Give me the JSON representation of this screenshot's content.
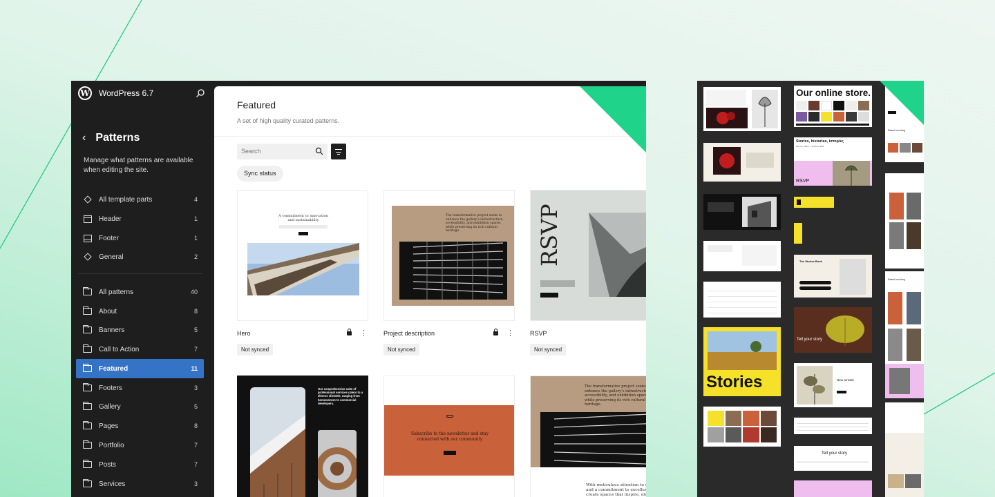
{
  "app": {
    "title": "WordPress 6.7"
  },
  "sidebar": {
    "back_title": "Patterns",
    "description": "Manage what patterns are available when editing the site.",
    "template_parts": [
      {
        "label": "All template parts",
        "count": "4",
        "icon": "diamond-icon"
      },
      {
        "label": "Header",
        "count": "1",
        "icon": "header-layout-icon"
      },
      {
        "label": "Footer",
        "count": "1",
        "icon": "footer-layout-icon"
      },
      {
        "label": "General",
        "count": "2",
        "icon": "diamond-icon"
      }
    ],
    "pattern_categories": [
      {
        "label": "All patterns",
        "count": "40"
      },
      {
        "label": "About",
        "count": "8"
      },
      {
        "label": "Banners",
        "count": "5"
      },
      {
        "label": "Call to Action",
        "count": "7"
      },
      {
        "label": "Featured",
        "count": "11",
        "active": true
      },
      {
        "label": "Footers",
        "count": "3"
      },
      {
        "label": "Gallery",
        "count": "5"
      },
      {
        "label": "Pages",
        "count": "8"
      },
      {
        "label": "Portfolio",
        "count": "7"
      },
      {
        "label": "Posts",
        "count": "7"
      },
      {
        "label": "Services",
        "count": "3"
      }
    ]
  },
  "main": {
    "title": "Featured",
    "subtitle": "A set of high quality curated patterns.",
    "search_placeholder": "Search",
    "filter_chip": "Sync status",
    "cards": [
      {
        "title": "Hero",
        "status": "Not synced",
        "preview_heading": "A commitment to innovation and sustainability"
      },
      {
        "title": "Project description",
        "status": "Not synced",
        "preview_heading": "The transformative project seeks to enhance the gallery's infrastructure, accessibility, and exhibition spaces while preserving its rich cultural heritage."
      },
      {
        "title": "RSVP",
        "status": "Not synced",
        "preview_heading": "RSVP"
      },
      {
        "title": "",
        "status": "",
        "preview_heading": "Our comprehensive suite of professional services caters to a diverse clientele, ranging from homeowners to commercial developers."
      },
      {
        "title": "",
        "status": "",
        "preview_heading": "Subscribe to the newsletter and stay connected with our community"
      },
      {
        "title": "",
        "status": "",
        "preview_heading": "The transformative project seeks to enhance the gallery's infrastructure, accessibility, and exhibition spaces while preserving its rich cultural heritage."
      }
    ],
    "bottom_snippet": "With meticulous attention to detail and a commitment to excellence, we create spaces that inspire, elevate, and enrich"
  },
  "overview": {
    "store_heading": "Our online store.",
    "stories_heading": "Stories, historias, iστορίες",
    "stories_date": "Dec 12, 2024 — 11:00 to 4PM",
    "rsvp": "RSVP",
    "book_title": "The Stories Book",
    "tell_story": "Tell your story",
    "stories_big": "Stories",
    "new_arrivals": "New arrivals",
    "search_blog": "Search our blog"
  },
  "colors": {
    "accent": "#3473c5",
    "sidebar_bg": "#1e1e1e",
    "brand_green": "#1fd38a",
    "stories_yellow": "#f5e12a",
    "rust": "#c9613a",
    "tan": "#b89c82"
  }
}
